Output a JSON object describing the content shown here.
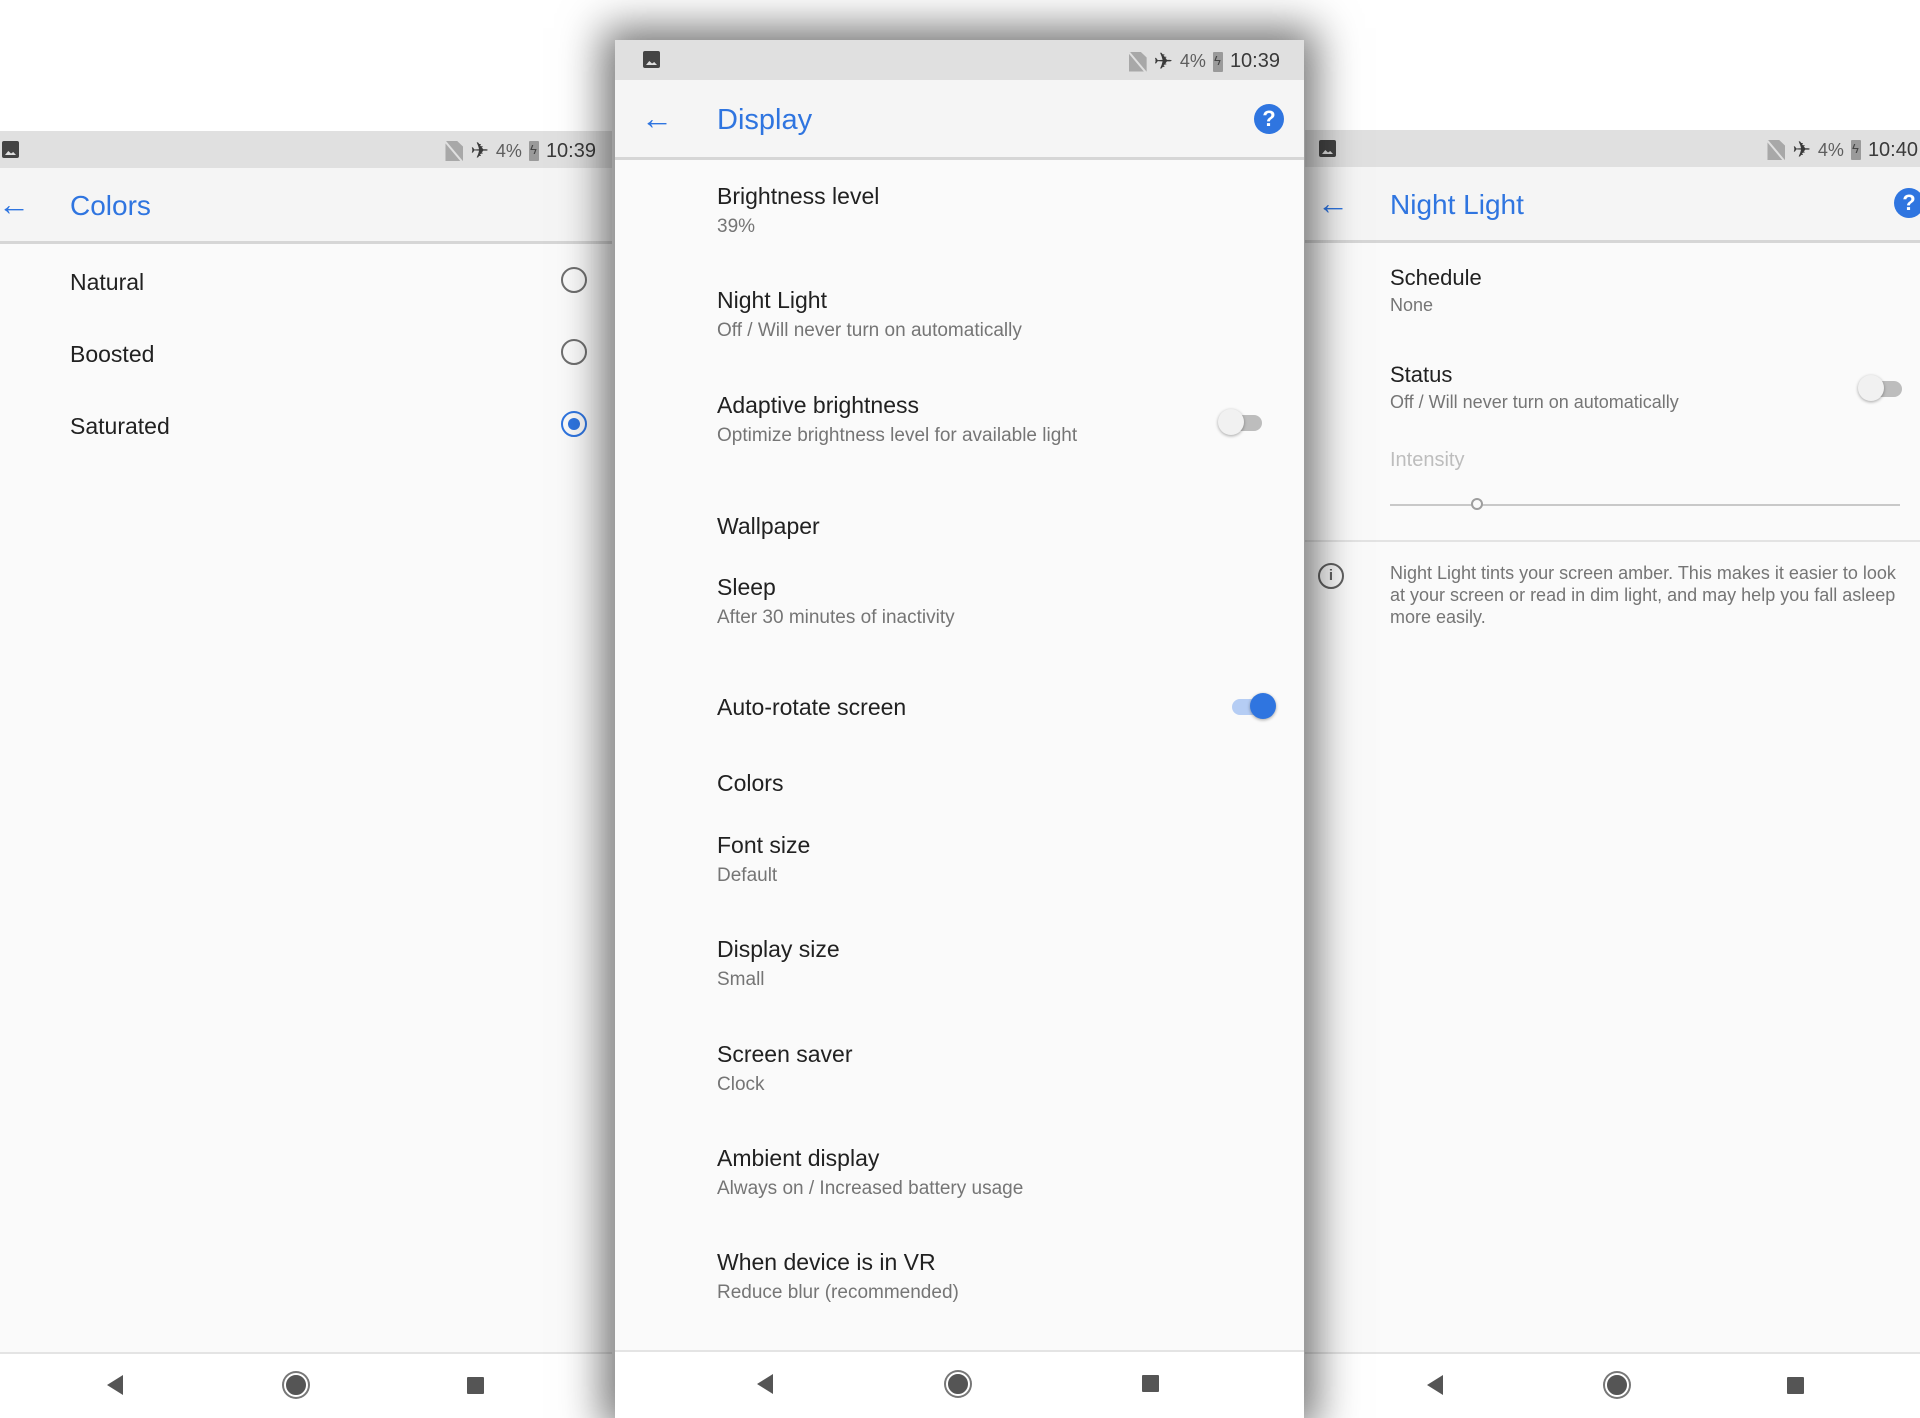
{
  "left_screen": {
    "status_bar": {
      "battery_percent": "4%",
      "time": "10:39",
      "left_icon": "image-notification-icon"
    },
    "app_bar": {
      "title": "Colors",
      "back_icon": "back-arrow-icon"
    },
    "options": [
      {
        "label": "Natural",
        "selected": false
      },
      {
        "label": "Boosted",
        "selected": false
      },
      {
        "label": "Saturated",
        "selected": true
      }
    ],
    "nav": {
      "back": "nav-back-icon",
      "home": "nav-home-icon",
      "recents": "nav-recents-icon"
    }
  },
  "center_screen": {
    "status_bar": {
      "battery_percent": "4%",
      "time": "10:39",
      "left_icon": "image-notification-icon"
    },
    "app_bar": {
      "title": "Display",
      "back_icon": "back-arrow-icon",
      "help_glyph": "?"
    },
    "items": [
      {
        "title": "Brightness level",
        "subtitle": "39%"
      },
      {
        "title": "Night Light",
        "subtitle": "Off / Will never turn on automatically"
      },
      {
        "title": "Adaptive brightness",
        "subtitle": "Optimize brightness level for available light",
        "toggle": "off"
      },
      {
        "title": "Wallpaper"
      },
      {
        "title": "Sleep",
        "subtitle": "After 30 minutes of inactivity"
      },
      {
        "title": "Auto-rotate screen",
        "toggle": "on"
      },
      {
        "title": "Colors"
      },
      {
        "title": "Font size",
        "subtitle": "Default"
      },
      {
        "title": "Display size",
        "subtitle": "Small"
      },
      {
        "title": "Screen saver",
        "subtitle": "Clock"
      },
      {
        "title": "Ambient display",
        "subtitle": "Always on / Increased battery usage"
      },
      {
        "title": "When device is in VR",
        "subtitle": "Reduce blur (recommended)"
      }
    ],
    "nav": {
      "back": "nav-back-icon",
      "home": "nav-home-icon",
      "recents": "nav-recents-icon"
    }
  },
  "right_screen": {
    "status_bar": {
      "battery_percent": "4%",
      "time": "10:40",
      "left_icon": "image-notification-icon"
    },
    "app_bar": {
      "title": "Night Light",
      "back_icon": "back-arrow-icon",
      "help_glyph": "?"
    },
    "schedule": {
      "title": "Schedule",
      "subtitle": "None"
    },
    "status": {
      "title": "Status",
      "subtitle": "Off / Will never turn on automatically",
      "toggle": "off"
    },
    "intensity": {
      "label": "Intensity",
      "value_fraction": 0.17,
      "enabled": false
    },
    "info_text": "Night Light tints your screen amber. This makes it easier to look at your screen or read in dim light, and may help you fall asleep more easily.",
    "info_glyph": "i",
    "nav": {
      "back": "nav-back-icon",
      "home": "nav-home-icon",
      "recents": "nav-recents-icon"
    }
  },
  "colors": {
    "accent": "#2f75e0",
    "status_bar": "#e0e0e0",
    "background": "#fafafa"
  }
}
